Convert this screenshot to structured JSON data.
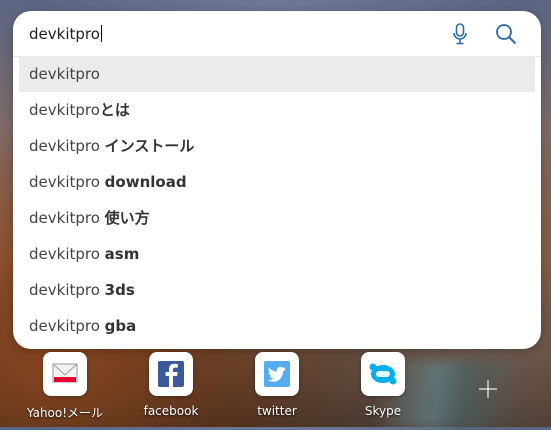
{
  "search": {
    "value": "devkitpro",
    "mic_icon": "microphone-icon",
    "search_icon": "search-icon"
  },
  "suggestions": [
    {
      "prefix": "devkitpro",
      "suffix": ""
    },
    {
      "prefix": "devkitpro",
      "suffix": "とは"
    },
    {
      "prefix": "devkitpro ",
      "suffix": "インストール"
    },
    {
      "prefix": "devkitpro ",
      "suffix": "download"
    },
    {
      "prefix": "devkitpro ",
      "suffix": "使い方"
    },
    {
      "prefix": "devkitpro ",
      "suffix": "asm"
    },
    {
      "prefix": "devkitpro ",
      "suffix": "3ds"
    },
    {
      "prefix": "devkitpro ",
      "suffix": "gba"
    }
  ],
  "tiles": [
    {
      "label": "Yahoo!メール",
      "icon": "yahoo-mail-icon"
    },
    {
      "label": "facebook",
      "icon": "facebook-icon",
      "color": "#3b5998"
    },
    {
      "label": "twitter",
      "icon": "twitter-icon",
      "color": "#55acee"
    },
    {
      "label": "Skype",
      "icon": "skype-icon",
      "color": "#00aff0"
    }
  ],
  "add_tile_icon": "plus-icon",
  "colors": {
    "accent": "#2b6cb0",
    "selected_row": "#ebebeb"
  }
}
